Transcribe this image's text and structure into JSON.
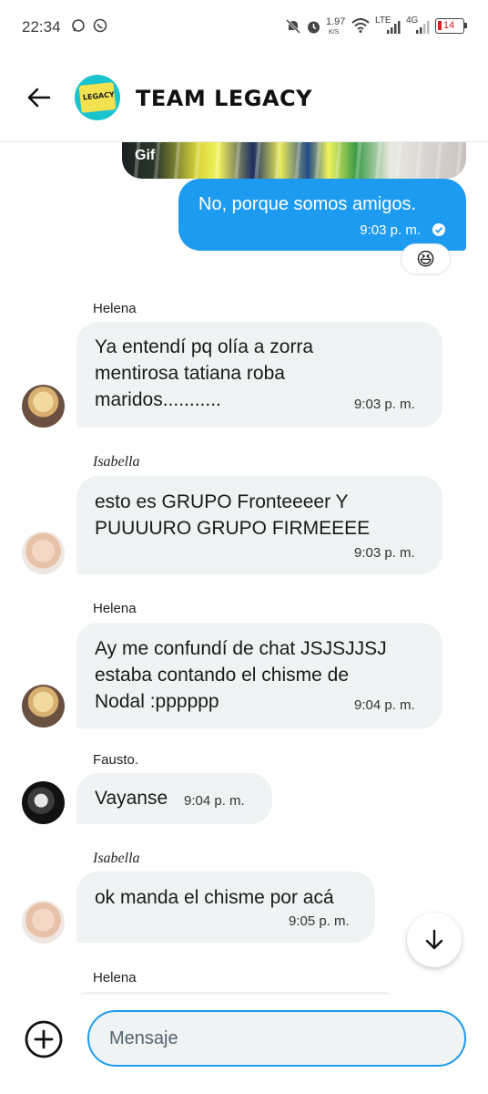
{
  "status_bar": {
    "time": "22:34",
    "net_speed": "1.97",
    "net_unit": "K/S",
    "lte": "LTE",
    "network_4g": "4G",
    "battery": "14"
  },
  "header": {
    "title": "TEAM LEGACY",
    "avatar_text": "LEGACY"
  },
  "chat": {
    "gif_label": "Gif",
    "my_message": {
      "text": "No, porque somos amigos.",
      "time": "9:03 p. m."
    },
    "reaction": "😆",
    "messages": [
      {
        "sender": "Helena",
        "lines": [
          "Ya entendí pq olía a zorra",
          "mentirosa tatiana roba",
          "maridos..........."
        ],
        "time": "9:03 p. m."
      },
      {
        "sender": "Isabella",
        "lines": [
          "esto es GRUPO Fronteeeer Y",
          "PUUUURO GRUPO FIRMEEEE"
        ],
        "time": "9:03 p. m."
      },
      {
        "sender": "Helena",
        "lines": [
          "Ay me confundí de chat JSJSJJSJ",
          "estaba contando el chisme de",
          "Nodal :pppppp"
        ],
        "time": "9:04 p. m."
      },
      {
        "sender": "Fausto.",
        "lines": [
          "Vayanse"
        ],
        "time": "9:04 p. m."
      },
      {
        "sender": "Isabella",
        "lines": [
          "ok manda el chisme por acá"
        ],
        "time": "9:05 p. m."
      },
      {
        "sender": "Helena"
      }
    ]
  },
  "composer": {
    "placeholder": "Mensaje"
  },
  "colors": {
    "accent": "#1d9bf0",
    "bubble_gray": "#eff3f4"
  }
}
